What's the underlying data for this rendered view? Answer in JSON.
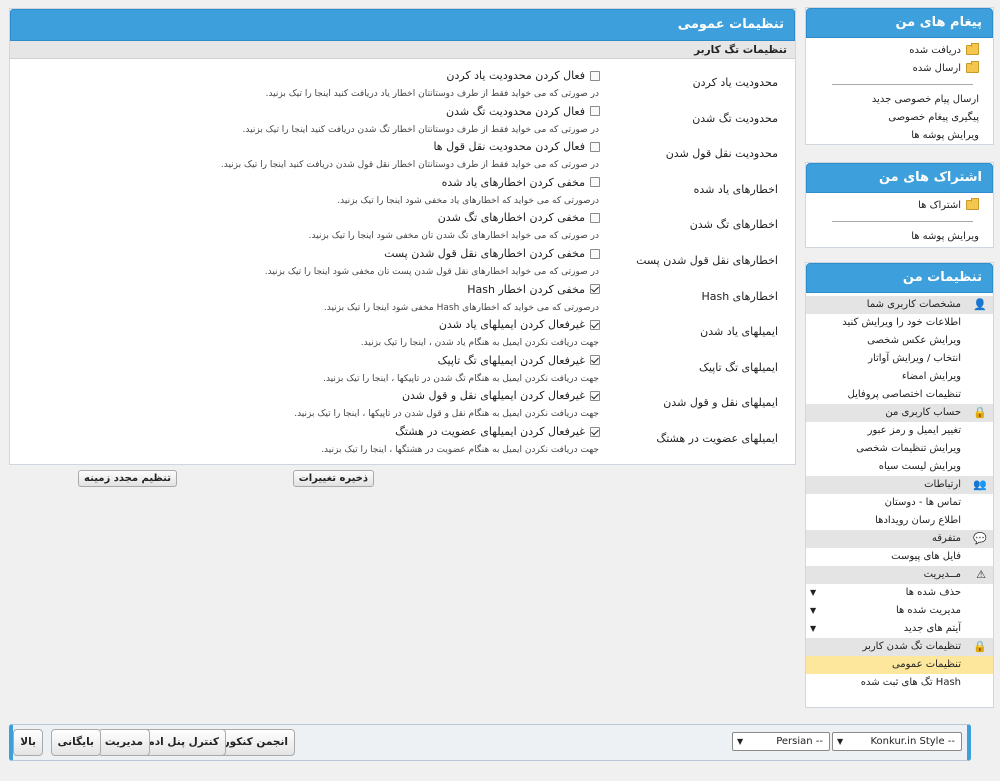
{
  "main": {
    "title": "تنظیمات عمومی",
    "subtitle": "تنظیمات تگ کاربر",
    "rows": [
      {
        "label": "محدودیت یاد کردن",
        "checkbox": "فعال کردن محدودیت یاد کردن",
        "checked": false,
        "desc": "در صورتی که می خواید فقط از طرف دوستانتان اخطار یاد دریافت کنید اینجا را تیک بزنید."
      },
      {
        "label": "محدودیت تگ شدن",
        "checkbox": "فعال کردن محدودیت تگ شدن",
        "checked": false,
        "desc": "در صورتی که می خواید فقط از طرف دوستانتان اخطار تگ شدن دریافت کنید اینجا را تیک بزنید."
      },
      {
        "label": "محدودیت نقل قول شدن",
        "checkbox": "فعال کردن محدودیت نقل قول ها",
        "checked": false,
        "desc": "در صورتی که می خواید فقط از طرف دوستانتان اخطار نقل قول شدن دریافت کنید اینجا را تیک بزنید."
      },
      {
        "label": "اخطارهای یاد شده",
        "checkbox": "مخفی کردن اخطارهای یاد شده",
        "checked": false,
        "desc": "درصورتی که می خواید که اخطارهای یاد مخفی شود اینجا را تیک بزنید."
      },
      {
        "label": "اخطارهای تگ شدن",
        "checkbox": "مخفی کردن اخطارهای تگ شدن",
        "checked": false,
        "desc": "در صورتی که می خواید اخطارهای تگ شدن تان مخفی شود اینجا را تیک بزنید."
      },
      {
        "label": "اخطارهای نقل قول شدن پست",
        "checkbox": "مخفی کردن اخطارهای نقل قول شدن پست",
        "checked": false,
        "desc": "در صورتی که می خواید اخطارهای نقل قول شدن پست تان مخفی شود اینجا را تیک بزنید."
      },
      {
        "label": "اخطارهای Hash",
        "checkbox": "مخفی کردن اخطار Hash",
        "checked": true,
        "desc": "درصورتی که می خواید که اخطارهای Hash مخفی شود اینجا را تیک بزنید."
      },
      {
        "label": "ایمیلهای یاد شدن",
        "checkbox": "غیرفعال کردن ایمیلهای یاد شدن",
        "checked": true,
        "desc": "جهت دریافت نکردن ایمیل به هنگام یاد شدن ، اینجا را تیک بزنید."
      },
      {
        "label": "ایمیلهای تگ تاپیک",
        "checkbox": "غیرفعال کردن ایمیلهای تگ تاپیک",
        "checked": true,
        "desc": "جهت دریافت نکردن ایمیل به هنگام تگ شدن در تاپیکها ، اینجا را تیک بزنید."
      },
      {
        "label": "ایمیلهای نقل و قول شدن",
        "checkbox": "غیرفعال کردن ایمیلهای نقل و قول شدن",
        "checked": true,
        "desc": "جهت دریافت نکردن ایمیل به هنگام نقل و قول شدن در تاپیکها ، اینجا را تیک بزنید."
      },
      {
        "label": "ایمیلهای عضویت در هشتگ",
        "checkbox": "غیرفعال کردن ایمیلهای عضویت در هشتگ",
        "checked": true,
        "desc": "جهت دریافت نکردن ایمیل به هنگام عضویت در هشتگها ، اینجا را تیک بزنید."
      }
    ],
    "save_label": "ذخیره تغییرات",
    "reset_label": "تنظیم مجدد زمینه"
  },
  "sidebar": {
    "messages": {
      "title": "پیغام های من",
      "folders": [
        "دریافت شده",
        "ارسال شده"
      ],
      "links": [
        "ارسال پیام خصوصی جدید",
        "پیگیری پیغام خصوصی",
        "ویرایش پوشه ها"
      ]
    },
    "subscriptions": {
      "title": "اشتراک های من",
      "folders": [
        "اشتراک ها"
      ],
      "links": [
        "ویرایش پوشه ها"
      ]
    },
    "settings": {
      "title": "تنظیمات من",
      "profile_cat": "مشخصات کاربری شما",
      "profile_links": [
        "اطلاعات خود را ویرایش کنید",
        "ویرایش عکس شخصی",
        "انتخاب / ویرایش آواتار",
        "ویرایش امضاء",
        "تنظیمات اختصاصی پروفایل"
      ],
      "account_cat": "حساب کاربری من",
      "account_links": [
        "تغییر ایمیل و رمز عبور",
        "ویرایش تنظیمات شخصی",
        "ویرایش لیست سیاه"
      ],
      "network_cat": "ارتباطات",
      "network_links": [
        "تماس ها - دوستان",
        "اطلاع رسان رویدادها"
      ],
      "misc_cat": "متفرقه",
      "misc_links": [
        "فایل های پیوست"
      ],
      "mod_cat": "مــدیریت",
      "mod_links": [
        "حذف شده ها",
        "مدیریت شده ها",
        "آیتم های جدید"
      ],
      "tag_cat": "تنظیمات تگ شدن کاربر",
      "tag_links": [
        "تنظیمات عمومی",
        "Hash تگ های ثبت شده"
      ]
    }
  },
  "footer": {
    "buttons": [
      "انجمن کنکور",
      "کنترل پنل ادمین",
      "مدیریت",
      "بایگانی",
      "بالا"
    ],
    "style_select": "-- Konkur.in Style",
    "lang_select": "-- Persian"
  },
  "colors": {
    "accent": "#3da0dc",
    "selected": "#fce79d",
    "category_bg": "#e4e4e4"
  }
}
